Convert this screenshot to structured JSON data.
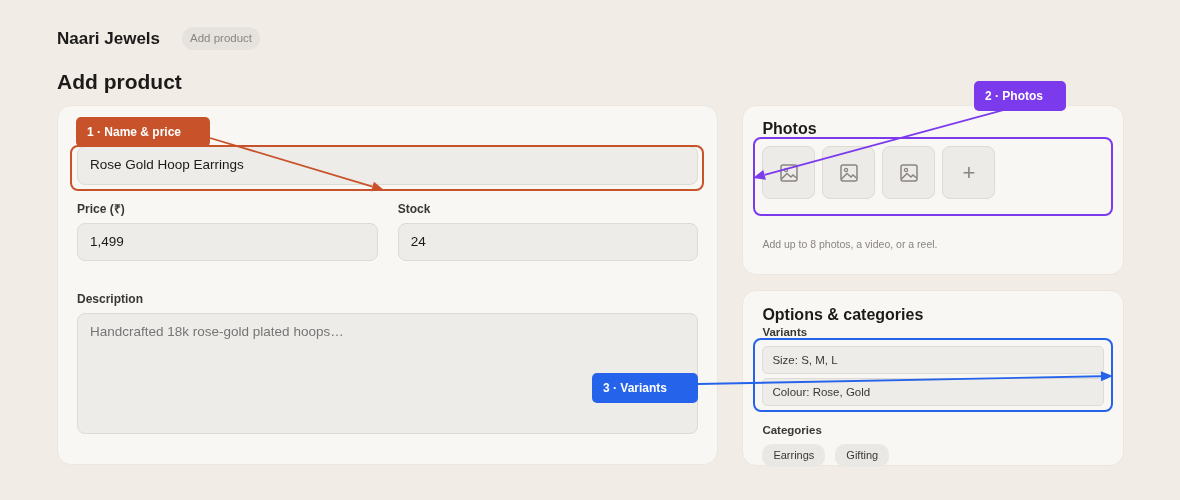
{
  "header": {
    "brand": "Naari Jewels",
    "breadcrumb": "Add product"
  },
  "page_title": "Add product",
  "product_form": {
    "name_field": {
      "value": "Rose Gold Hoop Earrings"
    },
    "price_field": {
      "label": "Price (₹)",
      "value": "1,499"
    },
    "stock_field": {
      "label": "Stock",
      "value": "24"
    },
    "description_field": {
      "label": "Description",
      "placeholder": "Handcrafted 18k rose-gold plated hoops…"
    }
  },
  "photos": {
    "title": "Photos",
    "slots": [
      {
        "kind": "photo"
      },
      {
        "kind": "photo"
      },
      {
        "kind": "photo"
      },
      {
        "kind": "add",
        "label": "+"
      }
    ],
    "hint": "Add up to 8 photos, a video, or a reel."
  },
  "options": {
    "title": "Options & categories",
    "variants_label": "Variants",
    "variants": [
      "Size: S, M, L",
      "Colour: Rose, Gold"
    ],
    "categories_label": "Categories",
    "categories": [
      "Earrings",
      "Gifting"
    ]
  },
  "annotations": [
    {
      "label": "1 · Name & price",
      "color": "#c8532b"
    },
    {
      "label": "2 · Photos",
      "color": "#7c3aed"
    },
    {
      "label": "3 · Variants",
      "color": "#2563eb"
    }
  ]
}
